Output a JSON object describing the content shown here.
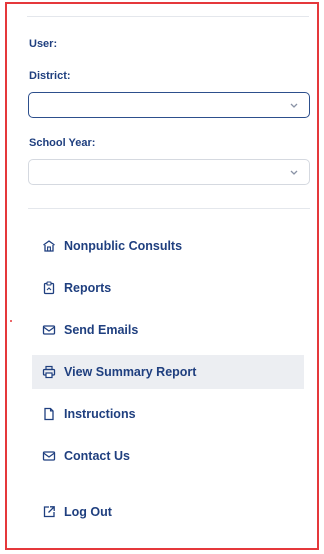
{
  "form": {
    "user_label": "User:",
    "district_label": "District:",
    "district_value": "",
    "school_year_label": "School Year:",
    "school_year_value": ""
  },
  "nav": {
    "items": [
      {
        "label": "Nonpublic Consults",
        "icon": "school-icon"
      },
      {
        "label": "Reports",
        "icon": "report-icon"
      },
      {
        "label": "Send Emails",
        "icon": "mail-icon"
      },
      {
        "label": "View Summary Report",
        "icon": "printer-icon",
        "active": true
      },
      {
        "label": "Instructions",
        "icon": "document-icon"
      },
      {
        "label": "Contact Us",
        "icon": "mail-icon"
      }
    ],
    "logout_label": "Log Out"
  },
  "colors": {
    "accent": "#1f3f7f",
    "border": "#e5383b",
    "active_bg": "#eceef2"
  }
}
